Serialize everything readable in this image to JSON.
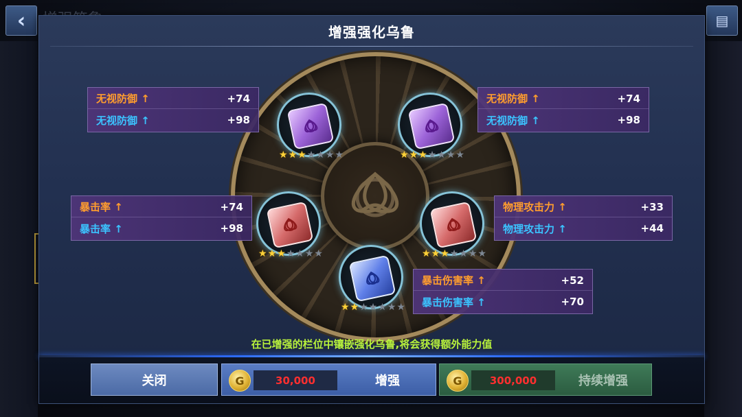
{
  "background": {
    "back_icon": "chevron-left-icon",
    "title": "增强符鲁",
    "menu_icon": "menu-icon"
  },
  "modal": {
    "title": "增强强化乌鲁",
    "hint": "在已增强的栏位中镶嵌强化乌鲁,将会获得额外能力值"
  },
  "runes": [
    {
      "id": "top-left",
      "color": "purple",
      "stars_filled": 3,
      "stars_total": 7
    },
    {
      "id": "top-right",
      "color": "purple",
      "stars_filled": 3,
      "stars_total": 7
    },
    {
      "id": "mid-left",
      "color": "red",
      "stars_filled": 3,
      "stars_total": 7
    },
    {
      "id": "mid-right",
      "color": "red",
      "stars_filled": 3,
      "stars_total": 7
    },
    {
      "id": "bottom",
      "color": "blue",
      "stars_filled": 2,
      "stars_total": 7
    }
  ],
  "stats": {
    "top_left": {
      "row1_label": "无视防御 ↑",
      "row1_value": "+74",
      "row2_label": "无视防御 ↑",
      "row2_value": "+98"
    },
    "top_right": {
      "row1_label": "无视防御 ↑",
      "row1_value": "+74",
      "row2_label": "无视防御 ↑",
      "row2_value": "+98"
    },
    "mid_left": {
      "row1_label": "暴击率 ↑",
      "row1_value": "+74",
      "row2_label": "暴击率 ↑",
      "row2_value": "+98"
    },
    "mid_right": {
      "row1_label": "物理攻击力 ↑",
      "row1_value": "+33",
      "row2_label": "物理攻击力 ↑",
      "row2_value": "+44"
    },
    "bottom": {
      "row1_label": "暴击伤害率 ↑",
      "row1_value": "+52",
      "row2_label": "暴击伤害率 ↑",
      "row2_value": "+70"
    }
  },
  "buttons": {
    "close": "关闭",
    "enhance": {
      "cost": "30,000",
      "label": "增强"
    },
    "continuous": {
      "cost": "300,000",
      "label": "持续增强"
    }
  },
  "colors": {
    "stat_row1": "#ff9d2e",
    "stat_row2": "#3bc3ff",
    "cost_text": "#ff2f2f",
    "hint_text": "#b8f23c"
  }
}
